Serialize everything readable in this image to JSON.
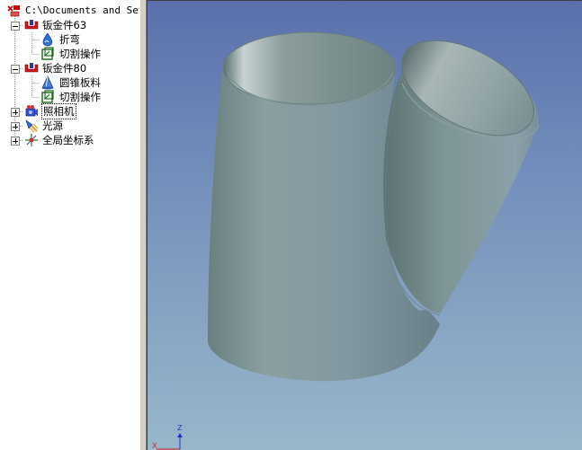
{
  "tree": {
    "root_path": "C:\\Documents and Sett",
    "nodes": [
      {
        "label": "钣金件63",
        "expander": "minus",
        "icon": "sheet-metal-icon"
      },
      {
        "label": "折弯",
        "icon": "bend-icon"
      },
      {
        "label": "切割操作",
        "icon": "cut-operation-icon"
      },
      {
        "label": "钣金件80",
        "expander": "minus",
        "icon": "sheet-metal-icon"
      },
      {
        "label": "圆锥板料",
        "icon": "cone-sheet-icon"
      },
      {
        "label": "切割操作",
        "icon": "cut-operation-icon"
      },
      {
        "label": "照相机",
        "expander": "plus",
        "icon": "camera-icon",
        "selected": true
      },
      {
        "label": "光源",
        "expander": "plus",
        "icon": "light-icon"
      },
      {
        "label": "全局坐标系",
        "expander": "plus",
        "icon": "global-coordinate-icon"
      }
    ]
  },
  "viewport": {
    "triad_z_label": "Z",
    "triad_x_label": "X",
    "colors": {
      "bg_top": "#5a70ac",
      "bg_bottom": "#99b7ca",
      "part": "#7f9595"
    }
  }
}
